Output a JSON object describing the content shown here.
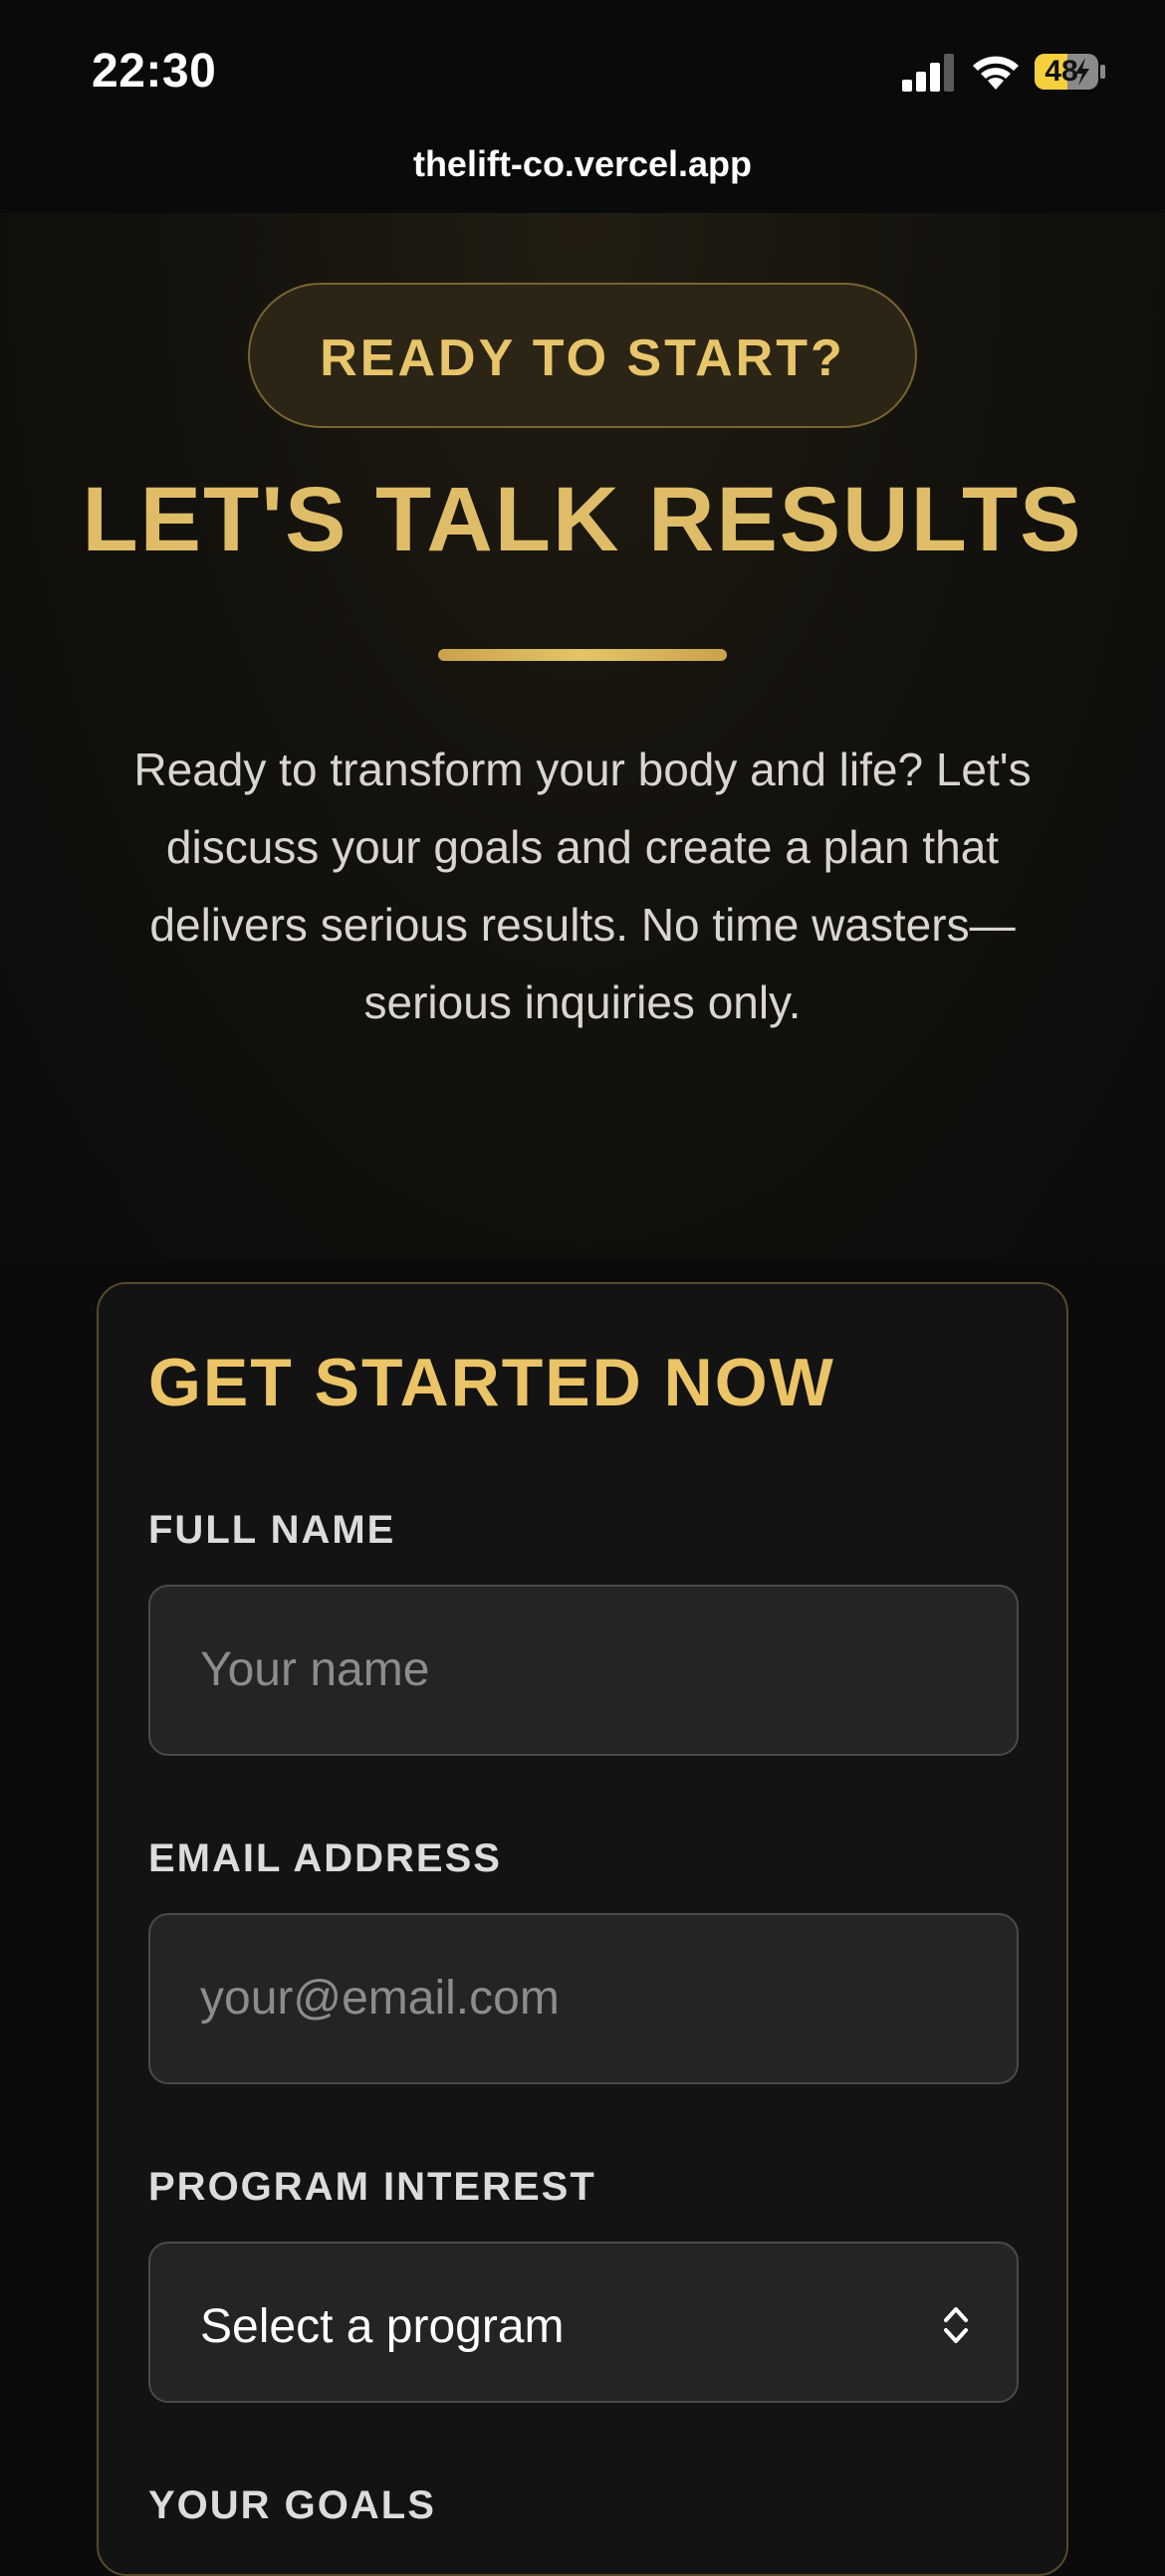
{
  "status_bar": {
    "time": "22:30",
    "battery_percent": "48",
    "icons": [
      "signal-icon",
      "wifi-icon",
      "battery-charging-icon"
    ]
  },
  "browser": {
    "url": "thelift-co.vercel.app"
  },
  "hero": {
    "pill_label": "READY TO START?",
    "title": "LET'S TALK RESULTS",
    "description": "Ready to transform your body and life? Let's discuss your goals and create a plan that delivers serious results. No time wasters—serious inquiries only."
  },
  "form": {
    "title": "GET STARTED NOW",
    "full_name": {
      "label": "FULL NAME",
      "placeholder": "Your name"
    },
    "email": {
      "label": "EMAIL ADDRESS",
      "placeholder": "your@email.com"
    },
    "program": {
      "label": "PROGRAM INTEREST",
      "selected": "Select a program"
    },
    "goals": {
      "label": "YOUR GOALS"
    }
  },
  "colors": {
    "accent_gold": "#e8c56a",
    "background": "#0b0b0b",
    "card_border": "#57492a"
  }
}
